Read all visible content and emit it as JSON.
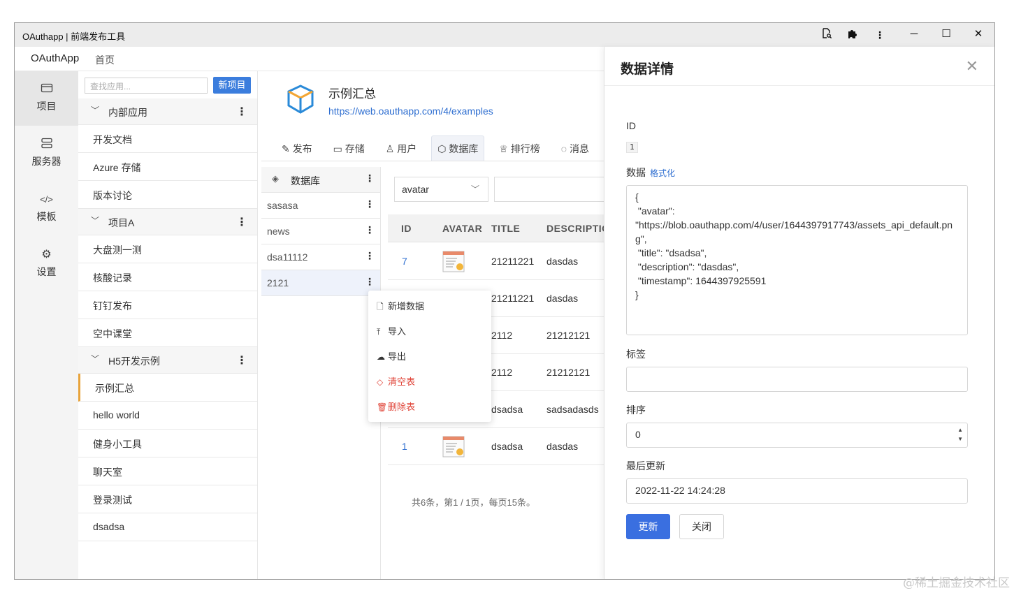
{
  "window": {
    "title": "OAuthapp | 前端发布工具",
    "controls": {
      "minimize": "─",
      "maximize": "☐",
      "close": "✕"
    }
  },
  "topnav": {
    "brand": "OAuthApp",
    "home": "首页"
  },
  "leftbar": [
    {
      "label": "项目",
      "icon": "folder-icon"
    },
    {
      "label": "服务器",
      "icon": "server-icon"
    },
    {
      "label": "模板",
      "icon": "code-icon"
    },
    {
      "label": "设置",
      "icon": "gear-icon"
    }
  ],
  "applist": {
    "search_placeholder": "查找应用...",
    "new_button": "新项目",
    "groups": [
      {
        "label": "内部应用",
        "items": [
          "开发文档",
          "Azure 存储",
          "版本讨论"
        ]
      },
      {
        "label": "项目A",
        "items": [
          "大盘测一测",
          "核酸记录",
          "钉钉发布",
          "空中课堂"
        ]
      },
      {
        "label": "H5开发示例",
        "items": [
          "示例汇总",
          "hello world",
          "健身小工具",
          "聊天室",
          "登录测试",
          "dsadsa"
        ]
      }
    ],
    "selected": "示例汇总"
  },
  "app": {
    "title": "示例汇总",
    "url": "https://web.oauthapp.com/4/examples",
    "tabs": [
      {
        "label": "发布",
        "icon": "edit-icon"
      },
      {
        "label": "存储",
        "icon": "storage-icon"
      },
      {
        "label": "用户",
        "icon": "user-icon"
      },
      {
        "label": "数据库",
        "icon": "cube-icon"
      },
      {
        "label": "排行榜",
        "icon": "trophy-icon"
      },
      {
        "label": "消息",
        "icon": "message-icon"
      }
    ],
    "active_tab": "数据库"
  },
  "databases": {
    "header": "数据库",
    "items": [
      "sasasa",
      "news",
      "dsa11112",
      "2121"
    ],
    "selected": "2121"
  },
  "filter": {
    "field_selected": "avatar",
    "query_value": ""
  },
  "table": {
    "columns": [
      "ID",
      "AVATAR",
      "TITLE",
      "DESCRIPTIO"
    ],
    "rows": [
      {
        "id": "7",
        "title": "21211221",
        "description": "dasdas"
      },
      {
        "id": "",
        "title": "21211221",
        "description": "dasdas"
      },
      {
        "id": "",
        "title": "2112",
        "description": "21212121"
      },
      {
        "id": "",
        "title": "2112",
        "description": "21212121"
      },
      {
        "id": "",
        "title": "dsadsa",
        "description": "sadsadasds"
      },
      {
        "id": "1",
        "title": "dsadsa",
        "description": "dasdas"
      }
    ],
    "footer": "共6条，第1 / 1页，每页15条。"
  },
  "context_menu": [
    {
      "label": "新增数据",
      "icon": "file-add-icon",
      "danger": false
    },
    {
      "label": "导入",
      "icon": "upload-icon",
      "danger": false
    },
    {
      "label": "导出",
      "icon": "download-icon",
      "danger": false
    },
    {
      "label": "清空表",
      "icon": "eraser-icon",
      "danger": true
    },
    {
      "label": "删除表",
      "icon": "trash-icon",
      "danger": true
    }
  ],
  "detail": {
    "title": "数据详情",
    "id_label": "ID",
    "id_value": "1",
    "data_label": "数据",
    "format_link": "格式化",
    "data_value": "{\n \"avatar\":\n\"https://blob.oauthapp.com/4/user/1644397917743/assets_api_default.png\",\n \"title\": \"dsadsa\",\n \"description\": \"dasdas\",\n \"timestamp\": 1644397925591\n}",
    "tags_label": "标签",
    "tags_value": "",
    "sort_label": "排序",
    "sort_value": "0",
    "updated_label": "最后更新",
    "updated_value": "2022-11-22 14:24:28",
    "update_button": "更新",
    "close_button": "关闭"
  },
  "watermark": "@稀土掘金技术社区",
  "colors": {
    "primary": "#3a6fe0",
    "link": "#2f6fd1",
    "danger": "#e0463a",
    "selected_accent": "#e8a33b"
  }
}
